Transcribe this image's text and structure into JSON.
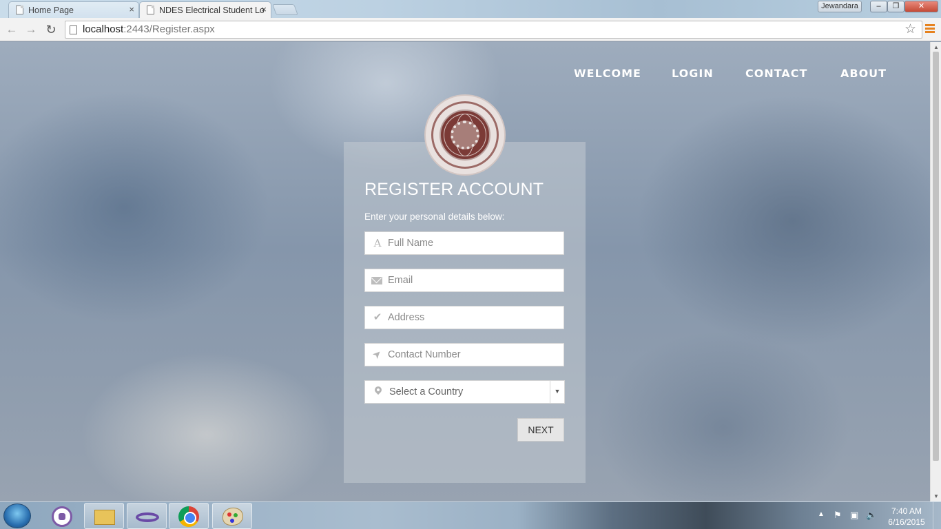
{
  "browser": {
    "tabs": [
      {
        "title": "Home Page",
        "close": "×"
      },
      {
        "title": "NDES Electrical Student Lo",
        "close": "×"
      }
    ],
    "user": "Jewandara",
    "window_controls": {
      "minimize": "‒",
      "maximize": "❐",
      "close": "✕"
    },
    "nav": {
      "back": "←",
      "forward": "→",
      "reload": "↻"
    },
    "url_host": "localhost",
    "url_rest": ":2443/Register.aspx",
    "star": "☆"
  },
  "site_nav": {
    "welcome": "WELCOME",
    "login": "LOGIN",
    "contact": "CONTACT",
    "about": "ABOUT"
  },
  "register": {
    "title": "REGISTER ACCOUNT",
    "subtitle": "Enter your personal details below:",
    "fields": {
      "full_name": "Full Name",
      "email": "Email",
      "address": "Address",
      "contact_number": "Contact Number"
    },
    "country_select": "Select a Country",
    "next_button": "NEXT"
  },
  "icons": {
    "name": "A",
    "address": "✔",
    "contact": "➤",
    "select_arrow": "▼"
  },
  "taskbar": {
    "time": "7:40 AM",
    "date": "6/16/2015",
    "tray_arrow": "▲",
    "flag": "⚑",
    "network": "▣",
    "volume": "🔈"
  }
}
